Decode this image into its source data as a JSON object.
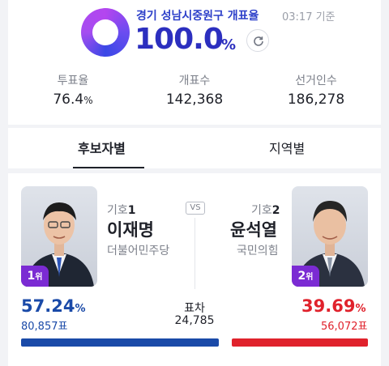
{
  "header": {
    "region": "경기 성남시중원구 개표율",
    "updated": "03:17 기준",
    "rate": "100.0",
    "rate_unit": "%"
  },
  "stats": [
    {
      "label": "투표율",
      "value": "76.4",
      "unit": "%"
    },
    {
      "label": "개표수",
      "value": "142,368",
      "unit": ""
    },
    {
      "label": "선거인수",
      "value": "186,278",
      "unit": ""
    }
  ],
  "tabs": [
    {
      "label": "후보자별",
      "active": true
    },
    {
      "label": "지역별",
      "active": false
    }
  ],
  "vs": "VS",
  "candidates": [
    {
      "symbol_prefix": "기호",
      "symbol_num": "1",
      "name": "이재명",
      "party": "더불어민주당",
      "rank": "1",
      "rank_unit": "위",
      "percent": "57.24",
      "percent_unit": "%",
      "votes": "80,857표",
      "color": "#1a4aa8"
    },
    {
      "symbol_prefix": "기호",
      "symbol_num": "2",
      "name": "윤석열",
      "party": "국민의힘",
      "rank": "2",
      "rank_unit": "위",
      "percent": "39.69",
      "percent_unit": "%",
      "votes": "56,072표",
      "color": "#e0222c"
    }
  ],
  "difference": {
    "label": "표차",
    "value": "24,785"
  },
  "icons": {
    "refresh": "refresh-icon",
    "photo": "candidate-photo"
  }
}
